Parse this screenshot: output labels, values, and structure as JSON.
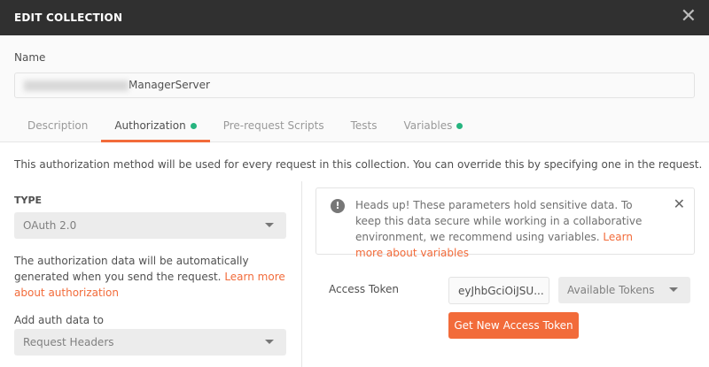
{
  "dialog": {
    "title": "EDIT COLLECTION",
    "close_icon": "close-icon"
  },
  "name": {
    "label": "Name",
    "value_suffix": "ManagerServer"
  },
  "tabs": [
    {
      "label": "Description"
    },
    {
      "label": "Authorization"
    },
    {
      "label": "Pre-request Scripts"
    },
    {
      "label": "Tests"
    },
    {
      "label": "Variables"
    }
  ],
  "auth": {
    "description": "This authorization method will be used for every request in this collection. You can override this by specifying one in the request.",
    "type_label": "TYPE",
    "type_value": "OAuth 2.0",
    "help_text": "The authorization data will be automatically generated when you send the request.",
    "help_link": "Learn more about authorization",
    "add_to_label": "Add auth data to",
    "add_to_value": "Request Headers"
  },
  "warning": {
    "text": "Heads up! These parameters hold sensitive data. To keep this data secure while working in a collaborative environment, we recommend using variables.",
    "link": "Learn more about variables"
  },
  "token": {
    "label": "Access Token",
    "value": "eyJhbGciOiJSU...",
    "available_placeholder": "Available Tokens",
    "get_new_label": "Get New Access Token"
  },
  "colors": {
    "accent": "#f26b3a",
    "dot": "#26b47f",
    "header": "#303030"
  }
}
